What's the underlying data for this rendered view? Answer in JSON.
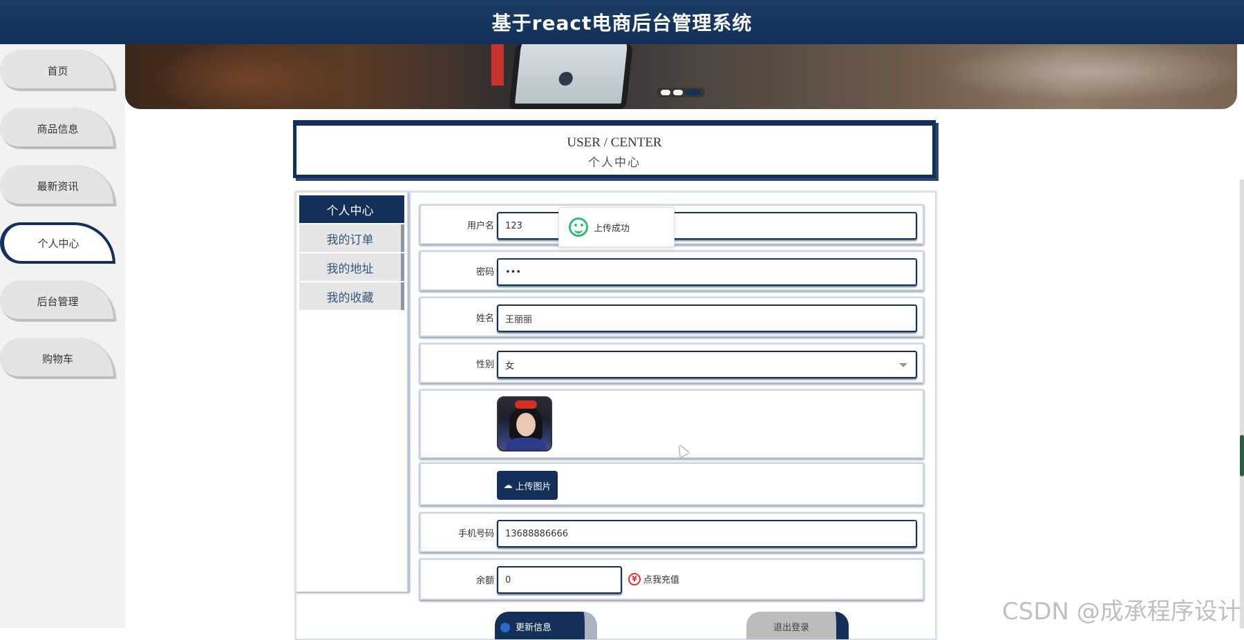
{
  "header": {
    "title": "基于react电商后台管理系统"
  },
  "sidebar": {
    "items": [
      {
        "label": "首页"
      },
      {
        "label": "商品信息"
      },
      {
        "label": "最新资讯"
      },
      {
        "label": "个人中心",
        "active": true
      },
      {
        "label": "后台管理"
      },
      {
        "label": "购物车"
      }
    ]
  },
  "banner": {
    "active_dot": 3,
    "dot_count": 3
  },
  "section": {
    "title_en": "USER / CENTER",
    "title_cn": "个人中心"
  },
  "tabs": [
    {
      "label": "个人中心",
      "active": true
    },
    {
      "label": "我的订单"
    },
    {
      "label": "我的地址"
    },
    {
      "label": "我的收藏"
    }
  ],
  "form": {
    "username": {
      "label": "用户名",
      "value": "123"
    },
    "password": {
      "label": "密码",
      "value": "•••"
    },
    "name": {
      "label": "姓名",
      "value": "王丽丽"
    },
    "gender": {
      "label": "性别",
      "value": "女"
    },
    "upload_label": "上传图片",
    "phone": {
      "label": "手机号码",
      "value": "13688886666"
    },
    "balance": {
      "label": "余额",
      "value": "0"
    },
    "recharge_label": "点我充值",
    "update_button": "更新信息",
    "logout_button": "退出登录"
  },
  "toast": {
    "message": "上传成功"
  },
  "watermark": "CSDN @成承程序设计",
  "colors": {
    "primary": "#123058",
    "success": "#2fbd73",
    "danger": "#e0322c"
  }
}
